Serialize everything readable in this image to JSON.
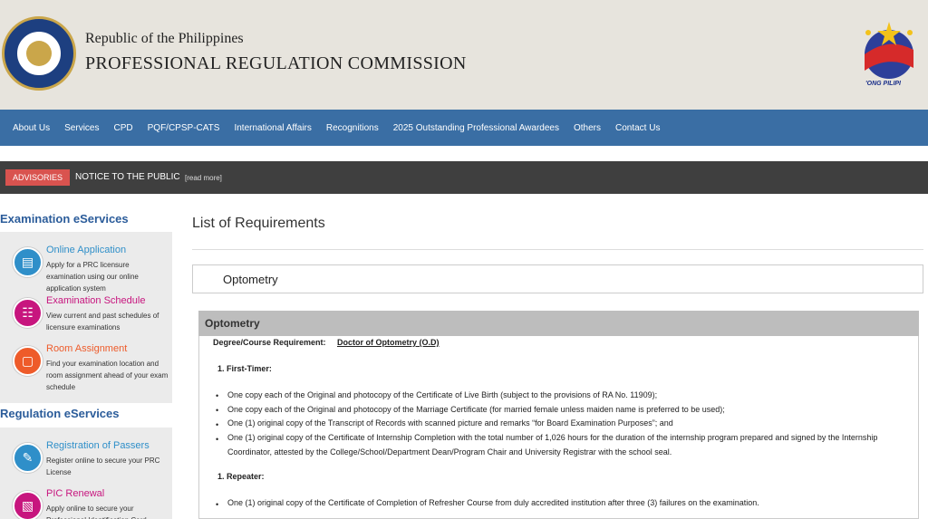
{
  "header": {
    "republic": "Republic of the Philippines",
    "commission": "PROFESSIONAL REGULATION COMMISSION",
    "bp_text": "'ONG PILIPI"
  },
  "nav": {
    "items": [
      "About Us",
      "Services",
      "CPD",
      "PQF/CPSP-CATS",
      "International Affairs",
      "Recognitions",
      "2025 Outstanding Professional Awardees",
      "Others",
      "Contact Us"
    ]
  },
  "advisory": {
    "tag": "ADVISORIES",
    "notice": "NOTICE TO THE PUBLIC",
    "read_more": "[read more]"
  },
  "sidebar": {
    "exam_title": "Examination eServices",
    "exam_services": [
      {
        "name": "Online Application",
        "desc": "Apply for a PRC licensure examination using our online application system",
        "color": "#2f8fc9"
      },
      {
        "name": "Examination Schedule",
        "desc": "View current and past schedules of licensure examinations",
        "color": "#c7157e"
      },
      {
        "name": "Room Assignment",
        "desc": "Find your examination location and room assignment ahead of your exam schedule",
        "color": "#ee5b2a"
      }
    ],
    "reg_title": "Regulation eServices",
    "reg_services": [
      {
        "name": "Registration of Passers",
        "desc": "Register online to secure your PRC License",
        "color": "#2f8fc9"
      },
      {
        "name": "PIC Renewal",
        "desc": "Apply online to secure your Professional Identification Card",
        "color": "#c7157e"
      }
    ]
  },
  "main": {
    "title": "List of Requirements",
    "selected": "Optometry",
    "panel_title": "Optometry",
    "degree_label": "Degree/Course Requirement:",
    "degree_value": "Doctor of Optometry (O.D)",
    "first_timer": "1.  First-Timer:",
    "first_items": [
      "One copy each of the Original and photocopy of the Certificate of Live Birth (subject to the provisions of RA No. 11909);",
      "One copy each of the Original and photocopy of the Marriage Certificate (for married female unless maiden name is preferred to be used);",
      "One (1) original copy of the Transcript of Records with scanned picture and remarks “for Board Examination Purposes”; and",
      "One (1) original copy of the Certificate of Internship Completion with the total number of 1,026 hours for the duration of the internship program prepared and signed by the Internship Coordinator, attested by the College/School/Department Dean/Program Chair and University Registrar with the school seal."
    ],
    "repeater": "1.  Repeater:",
    "repeater_items": [
      "One (1) original copy of the Certificate of Completion of Refresher Course from duly accredited institution after three (3) failures on the examination."
    ]
  }
}
